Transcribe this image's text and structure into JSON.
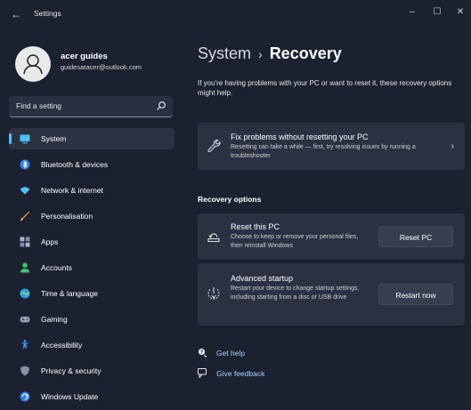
{
  "window": {
    "app_title": "Settings",
    "back_glyph": "←",
    "controls": {
      "minimize": "–",
      "maximize": "☐",
      "close": "✕"
    }
  },
  "profile": {
    "name": "acer guides",
    "email": "guidesatacer@outlook.com"
  },
  "search": {
    "placeholder": "Find a setting"
  },
  "sidebar": {
    "items": [
      {
        "label": "System",
        "icon": "monitor-icon",
        "color": "#4cc2ff",
        "active": true
      },
      {
        "label": "Bluetooth & devices",
        "icon": "bluetooth-icon",
        "color": "#3a8ee6"
      },
      {
        "label": "Network & internet",
        "icon": "wifi-icon",
        "color": "#4cc2ff"
      },
      {
        "label": "Personalisation",
        "icon": "brush-icon",
        "color": "#f0a030"
      },
      {
        "label": "Apps",
        "icon": "apps-icon",
        "color": "#8aa0c0"
      },
      {
        "label": "Accounts",
        "icon": "person-icon",
        "color": "#3ec46d"
      },
      {
        "label": "Time & language",
        "icon": "globe-clock-icon",
        "color": "#4cc2ff"
      },
      {
        "label": "Gaming",
        "icon": "gamepad-icon",
        "color": "#9aa3b2"
      },
      {
        "label": "Accessibility",
        "icon": "accessibility-icon",
        "color": "#3a9bff"
      },
      {
        "label": "Privacy & security",
        "icon": "shield-icon",
        "color": "#8a93a6"
      },
      {
        "label": "Windows Update",
        "icon": "update-icon",
        "color": "#3a9bff"
      }
    ]
  },
  "main": {
    "breadcrumb": {
      "parent": "System",
      "separator": "›",
      "current": "Recovery"
    },
    "intro": "If you're having problems with your PC or want to reset it, these recovery options might help.",
    "fix_card": {
      "title": "Fix problems without resetting your PC",
      "description": "Resetting can take a while — first, try resolving issues by running a troubleshooter",
      "chevron": "›"
    },
    "recovery_options_header": "Recovery options",
    "reset_card": {
      "title": "Reset this PC",
      "description": "Choose to keep or remove your personal files, then reinstall Windows",
      "button": "Reset PC"
    },
    "advanced_card": {
      "title": "Advanced startup",
      "description": "Restart your device to change startup settings, including starting from a disc or USB drive",
      "button": "Restart now"
    },
    "links": [
      {
        "label": "Get help",
        "icon": "help-icon"
      },
      {
        "label": "Give feedback",
        "icon": "feedback-icon"
      }
    ]
  }
}
